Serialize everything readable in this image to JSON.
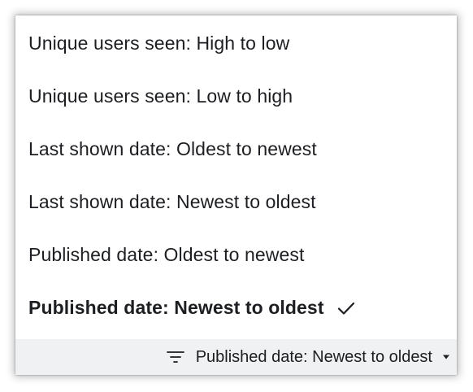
{
  "menu": {
    "items": [
      {
        "label": "Unique users seen: High to low",
        "selected": false
      },
      {
        "label": "Unique users seen: Low to high",
        "selected": false
      },
      {
        "label": "Last shown date: Oldest to newest",
        "selected": false
      },
      {
        "label": "Last shown date: Newest to oldest",
        "selected": false
      },
      {
        "label": "Published date: Oldest to newest",
        "selected": false
      },
      {
        "label": "Published date: Newest to oldest",
        "selected": true
      }
    ],
    "selected_icon": "check-icon"
  },
  "sort_bar": {
    "icon": "filter-lines-icon",
    "label": "Published date: Newest to oldest",
    "dropdown_icon": "caret-down-icon",
    "background": "#f0f1f3"
  },
  "colors": {
    "text": "#1c1e21",
    "menu_background": "#ffffff"
  }
}
